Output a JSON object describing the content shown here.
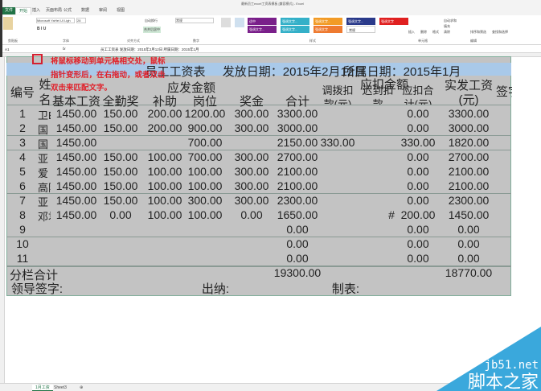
{
  "window": {
    "title": "最新员工excel工资表模板 [兼容模式] - Excel"
  },
  "ribbon": {
    "tabs": [
      "文件",
      "开始",
      "插入",
      "页面布局",
      "公式",
      "数据",
      "审阅",
      "视图"
    ],
    "font_name": "Microsoft YaHei UI Ligh",
    "font_size": "28",
    "wrap_text": "自动换行",
    "merge_center": "合并后居中",
    "number_format": "常规",
    "groups": [
      "剪贴板",
      "字体",
      "对齐方式",
      "数字",
      "样式",
      "单元格",
      "编辑"
    ],
    "style_cells": [
      {
        "label": "适中",
        "color": "#7a1f8a"
      },
      {
        "label": "强调文字...",
        "color": "#34b0c8"
      },
      {
        "label": "强调文字...",
        "color": "#f29b26"
      },
      {
        "label": "强调文字...",
        "color": "#2a3a8a"
      },
      {
        "label": "强调文字",
        "color": "#e02020"
      },
      {
        "label": "强调文字...",
        "color": "#7a1f8a"
      },
      {
        "label": "强调文字...",
        "color": "#34b0c8"
      },
      {
        "label": "强调文字",
        "color": "#ee7a30"
      },
      {
        "label": "常规",
        "color": "#ffffff"
      }
    ],
    "cells_buttons": [
      "插入",
      "删除",
      "格式"
    ],
    "edit_buttons": [
      "自动求和",
      "填充",
      "清除",
      "排序和筛选",
      "查找和选择"
    ]
  },
  "formula_bar": {
    "name_box": "A1",
    "fx": "fx",
    "content": "员工工资表   发放日期：2015年2月12日 所属日期：2015年1月"
  },
  "annotation": {
    "lines": [
      "将鼠标移动到单元格相交处，鼠标",
      "指针变形后，在右拖动，或者双击",
      "双击来匹配文字。"
    ]
  },
  "sheet": {
    "title": "员工工资表",
    "issue_date": "发放日期：2015年2月12日",
    "period": "所属日期：2015年1月",
    "headers": {
      "no": "编号",
      "name": "姓名",
      "payable": "应发金额",
      "deduct": "应扣金额",
      "net": "实发工资",
      "net_unit": "(元)",
      "sign": "签字",
      "cols": [
        "基本工资",
        "全勤奖",
        "补助",
        "岗位",
        "奖金",
        "合计",
        "调拨扣款(元)",
        "迟到扣款",
        "应扣合计(元)"
      ]
    },
    "rows": [
      [
        "1",
        "卫E",
        "1450.00",
        "150.00",
        "200.00",
        "1200.00",
        "300.00",
        "3300.00",
        "",
        "",
        "0.00",
        "3300.00"
      ],
      [
        "2",
        "国",
        "1450.00",
        "150.00",
        "200.00",
        "900.00",
        "300.00",
        "3000.00",
        "",
        "",
        "0.00",
        "3000.00"
      ],
      [
        "3",
        "国",
        "1450.00",
        "",
        "",
        "700.00",
        "",
        "2150.00",
        "330.00",
        "",
        "330.00",
        "1820.00"
      ],
      [
        "4",
        "亚",
        "1450.00",
        "150.00",
        "100.00",
        "700.00",
        "300.00",
        "2700.00",
        "",
        "",
        "0.00",
        "2700.00"
      ],
      [
        "5",
        "爱",
        "1450.00",
        "150.00",
        "100.00",
        "100.00",
        "300.00",
        "2100.00",
        "",
        "",
        "0.00",
        "2100.00"
      ],
      [
        "6",
        "高阳",
        "1450.00",
        "150.00",
        "100.00",
        "100.00",
        "300.00",
        "2100.00",
        "",
        "",
        "0.00",
        "2100.00"
      ],
      [
        "7",
        "亚",
        "1450.00",
        "150.00",
        "100.00",
        "300.00",
        "300.00",
        "2300.00",
        "",
        "",
        "0.00",
        "2300.00"
      ],
      [
        "8",
        "邓君",
        "1450.00",
        "0.00",
        "100.00",
        "100.00",
        "0.00",
        "1650.00",
        "",
        "#",
        "200.00",
        "1450.00"
      ],
      [
        "9",
        "",
        "",
        "",
        "",
        "",
        "",
        "0.00",
        "",
        "",
        "0.00",
        "0.00"
      ],
      [
        "10",
        "",
        "",
        "",
        "",
        "",
        "",
        "0.00",
        "",
        "",
        "0.00",
        "0.00"
      ],
      [
        "11",
        "",
        "",
        "",
        "",
        "",
        "",
        "0.00",
        "",
        "",
        "0.00",
        "0.00"
      ]
    ],
    "subtotal_label": "分栏合计",
    "subtotal_total": "19300.00",
    "subtotal_net": "18770.00",
    "sign_leader": "领导签字:",
    "sign_cashier": "出纳:",
    "sign_maker": "制表:"
  },
  "sheet_tabs": [
    "1月工资",
    "Sheet3"
  ],
  "watermark": {
    "site": "jb51.net",
    "name": "脚本之家",
    "color": "#3aa8dc"
  }
}
